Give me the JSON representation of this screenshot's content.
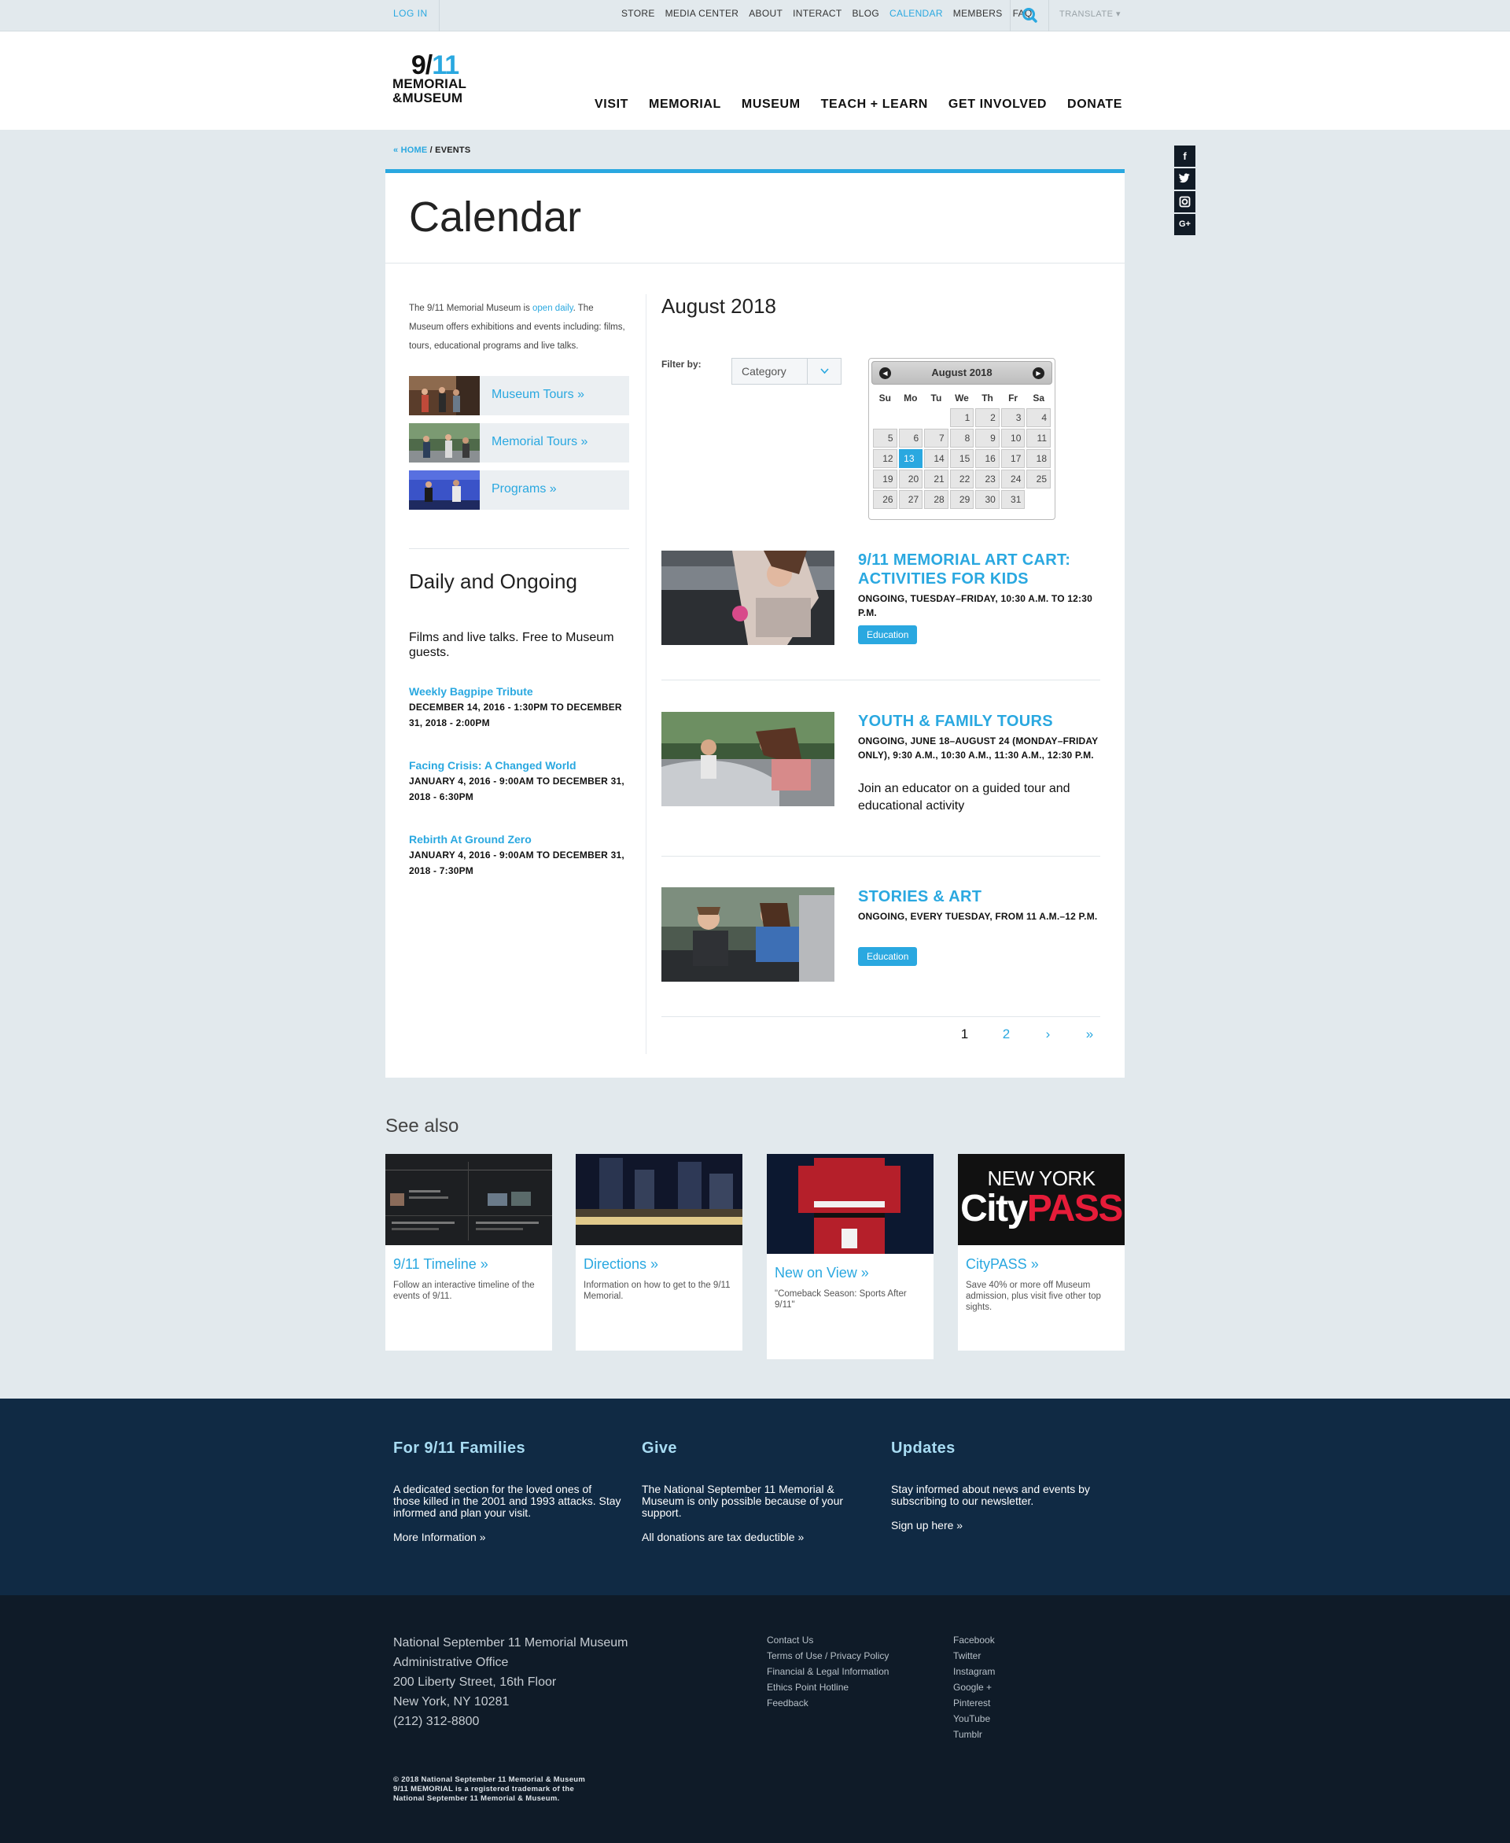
{
  "topbar": {
    "login": "LOG IN",
    "utility_links": [
      "STORE",
      "MEDIA CENTER",
      "ABOUT",
      "INTERACT",
      "BLOG",
      "CALENDAR",
      "MEMBERS",
      "FAQ"
    ],
    "active_link": "CALENDAR",
    "translate": "TRANSLATE ▾"
  },
  "logo": {
    "line1_a": "9/",
    "line1_b": "11",
    "line2": "MEMORIAL",
    "line3": "&MUSEUM"
  },
  "main_nav": [
    "VISIT",
    "MEMORIAL",
    "MUSEUM",
    "TEACH + LEARN",
    "GET INVOLVED",
    "DONATE"
  ],
  "breadcrumb": {
    "home": "« HOME",
    "sep": " / ",
    "current": "EVENTS"
  },
  "social_icons": [
    "facebook-icon",
    "twitter-icon",
    "instagram-icon",
    "google-plus-icon"
  ],
  "page_title": "Calendar",
  "intro": {
    "before": "The 9/11 Memorial Museum is ",
    "link": "open daily",
    "after": ". The Museum offers exhibitions and events including: films, tours, educational programs and live talks."
  },
  "quick_links": [
    {
      "label": "Museum Tours »"
    },
    {
      "label": "Memorial Tours »"
    },
    {
      "label": "Programs »"
    }
  ],
  "daily": {
    "title": "Daily and Ongoing",
    "description": "Films and live talks. Free to Museum guests.",
    "events": [
      {
        "title": "Weekly Bagpipe Tribute",
        "dates": "DECEMBER 14, 2016 - 1:30PM TO DECEMBER 31, 2018 - 2:00PM"
      },
      {
        "title": "Facing Crisis: A Changed World",
        "dates": "JANUARY 4, 2016 - 9:00AM TO DECEMBER 31, 2018 - 6:30PM"
      },
      {
        "title": "Rebirth At Ground Zero",
        "dates": "JANUARY 4, 2016 - 9:00AM TO DECEMBER 31, 2018 - 7:30PM"
      }
    ]
  },
  "calendar": {
    "month_title": "August 2018",
    "filter_label": "Filter by:",
    "filter_value": "Category",
    "widget_month": "August 2018",
    "weekdays": [
      "Su",
      "Mo",
      "Tu",
      "We",
      "Th",
      "Fr",
      "Sa"
    ],
    "weeks": [
      [
        "",
        "",
        "",
        "1",
        "2",
        "3",
        "4"
      ],
      [
        "5",
        "6",
        "7",
        "8",
        "9",
        "10",
        "11"
      ],
      [
        "12",
        "13",
        "14",
        "15",
        "16",
        "17",
        "18"
      ],
      [
        "19",
        "20",
        "21",
        "22",
        "23",
        "24",
        "25"
      ],
      [
        "26",
        "27",
        "28",
        "29",
        "30",
        "31",
        ""
      ]
    ],
    "selected_day": "13"
  },
  "events": [
    {
      "title": "9/11 MEMORIAL ART CART: ACTIVITIES FOR KIDS",
      "dates": "ONGOING, TUESDAY–FRIDAY, 10:30 A.M. TO 12:30 P.M.",
      "tag": "Education",
      "description": ""
    },
    {
      "title": "YOUTH & FAMILY TOURS",
      "dates": "ONGOING, JUNE 18–AUGUST 24 (MONDAY–FRIDAY ONLY), 9:30 A.M., 10:30 A.M., 11:30 A.M., 12:30 P.M.",
      "tag": "",
      "description": "Join an educator on a guided tour and educational activity"
    },
    {
      "title": "STORIES & ART",
      "dates": "ONGOING, EVERY TUESDAY, FROM 11 A.M.–12 P.M.",
      "tag": "Education",
      "description": ""
    }
  ],
  "pager": [
    "1",
    "2",
    "›",
    "»"
  ],
  "see_also": {
    "title": "See also",
    "cards": [
      {
        "title": "9/11 Timeline »",
        "desc": "Follow an interactive timeline of the events of 9/11."
      },
      {
        "title": "Directions »",
        "desc": "Information on how to get to the 9/11 Memorial."
      },
      {
        "title": "New on View »",
        "desc": "\"Comeback Season: Sports After 9/11\""
      },
      {
        "title": "CityPASS »",
        "desc": "Save 40% or more off Museum admission, plus visit five other top sights."
      }
    ],
    "citypass_logo": {
      "line1": "NEW YORK",
      "line2a": "City",
      "line2b": "PASS"
    }
  },
  "footer_top": [
    {
      "heading": "For 9/11 Families",
      "text": "A dedicated section for the loved ones of those killed in the 2001 and 1993 attacks. Stay informed and plan your visit.",
      "link": "More Information »"
    },
    {
      "heading": "Give",
      "text": "The National September 11 Memorial & Museum is only possible because of your support.",
      "link": "All donations are tax deductible »"
    },
    {
      "heading": "Updates",
      "text": "Stay informed about news and events by subscribing to our newsletter.",
      "link": "Sign up here »"
    }
  ],
  "footer_bottom": {
    "address": [
      "National September 11 Memorial Museum",
      "Administrative Office",
      "200 Liberty Street, 16th Floor",
      "New York, NY 10281",
      "(212) 312-8800"
    ],
    "links": [
      "Contact Us",
      "Terms of Use / Privacy Policy",
      "Financial & Legal Information",
      "Ethics Point Hotline",
      "Feedback"
    ],
    "social_links": [
      "Facebook",
      "Twitter",
      "Instagram",
      "Google +",
      "Pinterest",
      "YouTube",
      "Tumblr"
    ],
    "copyright": [
      "© 2018 National September 11 Memorial & Museum",
      "9/11 MEMORIAL is a registered trademark of the",
      "National September 11 Memorial & Museum."
    ]
  },
  "colors": {
    "accent": "#2aa8e0",
    "footer_top": "#102a44",
    "footer_bottom": "#0f1b28"
  }
}
